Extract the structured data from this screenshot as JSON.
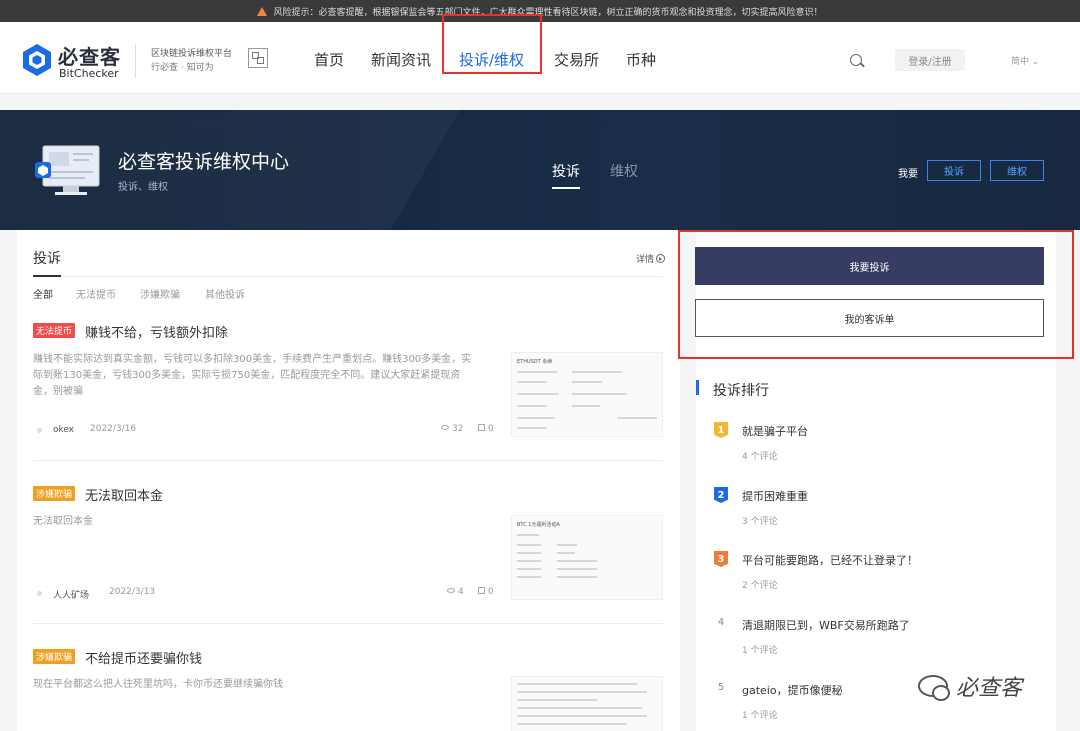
{
  "risk_notice": "风险提示：必查客提醒，根据银保监会等五部门文件，广大群众需理性看待区块链，树立正确的货币观念和投资理念，切实提高风险意识！",
  "header": {
    "logo_cn": "必查客",
    "logo_en": "BitChecker",
    "slogan1": "区块链投诉维权平台",
    "slogan2": "行必查 · 知可为",
    "nav": [
      "首页",
      "新闻资讯",
      "投诉/维权",
      "交易所",
      "币种"
    ],
    "login": "登录/注册",
    "lang": "简中"
  },
  "banner": {
    "title": "必查客投诉维权中心",
    "subtitle": "投诉、维权",
    "tabs": [
      "投诉",
      "维权"
    ],
    "want_label": "我要",
    "btn_complain": "投诉",
    "btn_rights": "维权"
  },
  "complaints": {
    "title": "投诉",
    "details": "详情",
    "filters": [
      "全部",
      "无法提币",
      "涉嫌欺骗",
      "其他投诉"
    ],
    "posts": [
      {
        "tag": "无法提币",
        "title": "赚钱不给，亏钱额外扣除",
        "desc": "赚钱不能实际达到真实金额，亏钱可以多扣除300美金，手续费产生严重划点。赚钱300多美金，实际到账130美金，亏钱300多美金，实际亏损750美金，匹配程度完全不同。建议大家赶紧提现资金，别被骗",
        "user": "okex",
        "date": "2022/3/16",
        "views": "32",
        "comments": "0",
        "thumb_title": "ETHUSDT 永续"
      },
      {
        "tag": "涉嫌欺骗",
        "title": "无法取回本金",
        "desc": "无法取回本金",
        "user": "人人矿场",
        "date": "2022/3/13",
        "views": "4",
        "comments": "0",
        "thumb_title": "BTC 1元福利活动A"
      },
      {
        "tag": "涉嫌欺骗",
        "title": "不给提币还要骗你钱",
        "desc": "现在平台都这么把人往死里坑吗，卡你币还要继续骗你钱",
        "thumb_title": ""
      }
    ]
  },
  "sidebar": {
    "btn_primary": "我要投诉",
    "btn_secondary": "我的客诉单",
    "rank_title": "投诉排行",
    "ranks": [
      {
        "num": "1",
        "text": "就是骗子平台",
        "count": "4 个评论"
      },
      {
        "num": "2",
        "text": "提币困难重重",
        "count": "3 个评论"
      },
      {
        "num": "3",
        "text": "平台可能要跑路，已经不让登录了！",
        "count": "2 个评论"
      },
      {
        "num": "4",
        "text": "清退期限已到，WBF交易所跑路了",
        "count": "1 个评论"
      },
      {
        "num": "5",
        "text": "gateio，提币像便秘",
        "count": "1 个评论"
      }
    ]
  },
  "watermark": "必查客",
  "colors": {
    "accent": "#1c6ae4",
    "highlight": "#e8312b",
    "banner": "#13233a",
    "primary_button": "#363c63"
  }
}
